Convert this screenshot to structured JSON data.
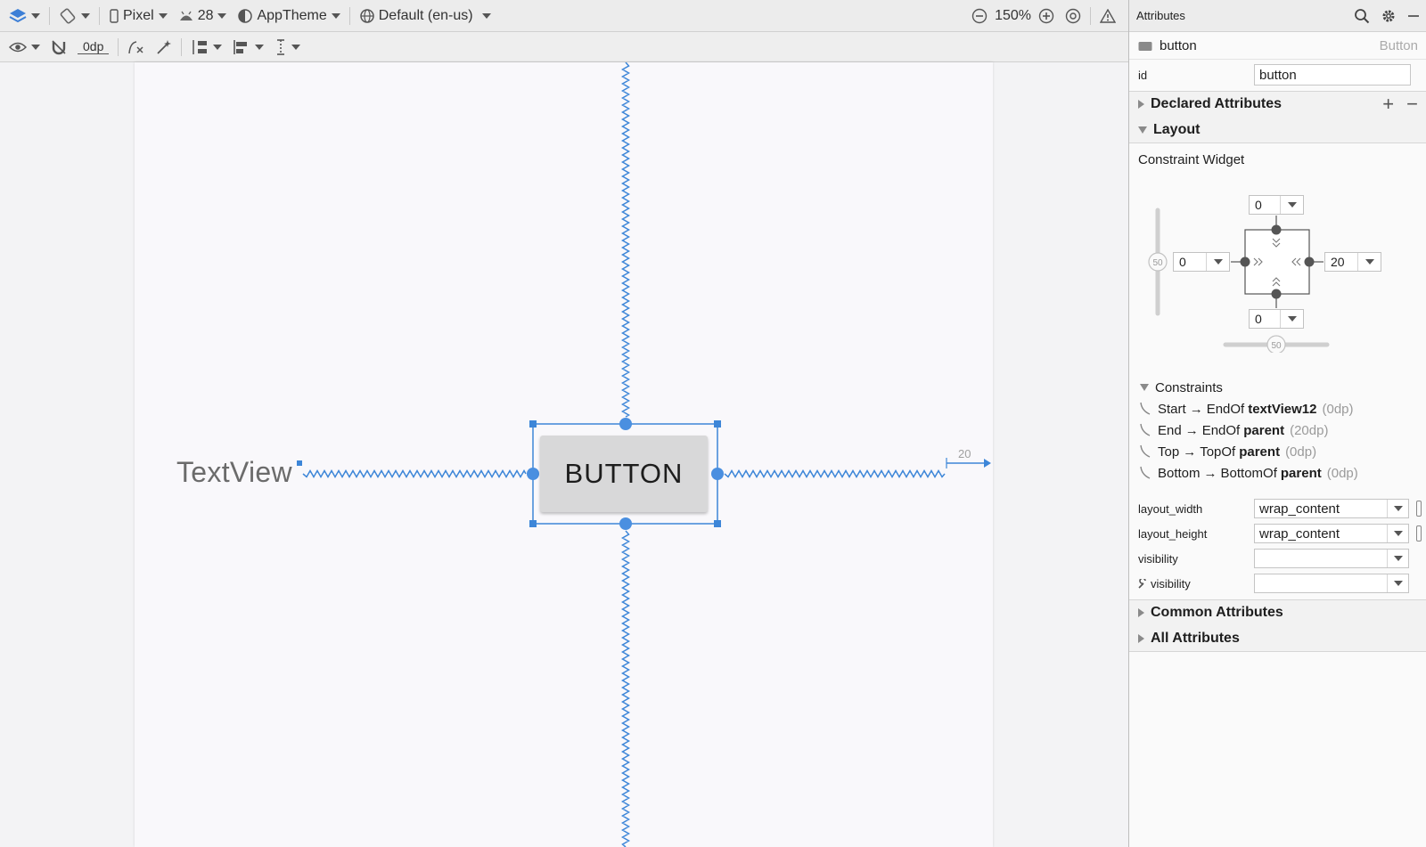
{
  "toolbar1": {
    "device": "Pixel",
    "api_level": "28",
    "theme": "AppTheme",
    "locale": "Default (en-us)",
    "zoom": "150%"
  },
  "toolbar2": {
    "default_margin": "0dp"
  },
  "canvas": {
    "textview_text": "TextView",
    "button_text": "BUTTON",
    "end_margin_label": "20"
  },
  "panel": {
    "title": "Attributes",
    "component_name": "button",
    "component_type": "Button",
    "id_label": "id",
    "id_value": "button",
    "sections": {
      "declared": "Declared Attributes",
      "layout": "Layout",
      "common": "Common Attributes",
      "all": "All Attributes"
    },
    "constraint_widget": {
      "label": "Constraint Widget",
      "top": "0",
      "bottom": "0",
      "start": "0",
      "end": "20",
      "vertical_bias": "50",
      "horizontal_bias": "50"
    },
    "constraints_header": "Constraints",
    "constraints": [
      {
        "side": "Start",
        "target_anchor": "EndOf",
        "target": "textView12",
        "margin": "(0dp)"
      },
      {
        "side": "End",
        "target_anchor": "EndOf",
        "target": "parent",
        "margin": "(20dp)"
      },
      {
        "side": "Top",
        "target_anchor": "TopOf",
        "target": "parent",
        "margin": "(0dp)"
      },
      {
        "side": "Bottom",
        "target_anchor": "BottomOf",
        "target": "parent",
        "margin": "(0dp)"
      }
    ],
    "attributes": [
      {
        "label": "layout_width",
        "value": "wrap_content"
      },
      {
        "label": "layout_height",
        "value": "wrap_content"
      },
      {
        "label": "visibility",
        "value": ""
      },
      {
        "label": "visibility",
        "value": ""
      }
    ]
  },
  "colors": {
    "accent": "#4a8fe0",
    "blueprint_line": "#3d86d8"
  }
}
